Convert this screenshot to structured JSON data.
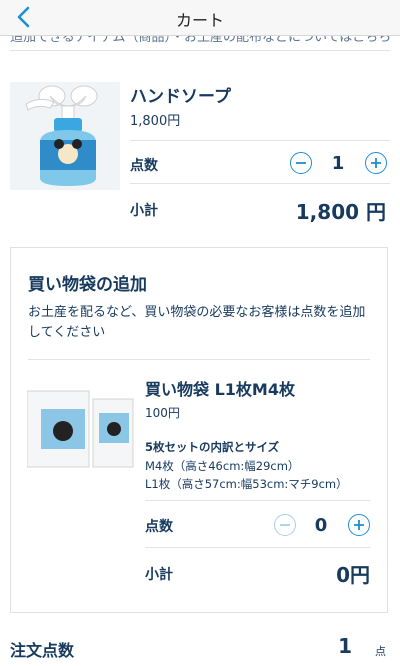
{
  "header": {
    "title": "カート"
  },
  "cut_text": "追加できるアイテム（商品）・お土産の配布などについてはこちら",
  "product": {
    "name": "ハンドソープ",
    "price": "1,800円",
    "quantity_label": "点数",
    "quantity": "1",
    "subtotal_label": "小計",
    "subtotal": "1,800 円",
    "image_icon": "soap-dispenser-image"
  },
  "bag_section": {
    "title": "買い物袋の追加",
    "description": "お土産を配るなど、買い物袋の必要なお客様は点数を追加してください",
    "item": {
      "name": "買い物袋 L1枚M4枚",
      "price": "100円",
      "set_title": "5枚セットの内訳とサイズ",
      "set_line1": "M4枚（高さ46cm:幅29cm）",
      "set_line2": "L1枚（高さ57cm:幅53cm:マチ9cm）",
      "quantity_label": "点数",
      "quantity": "0",
      "subtotal_label": "小計",
      "subtotal": "0円",
      "image_icon": "shopping-bag-image"
    }
  },
  "footer": {
    "label": "注文点数",
    "count": "1",
    "unit": "点"
  },
  "colors": {
    "accent": "#1d8fd2",
    "text": "#173a5e",
    "disabled": "#a9cfe6"
  }
}
